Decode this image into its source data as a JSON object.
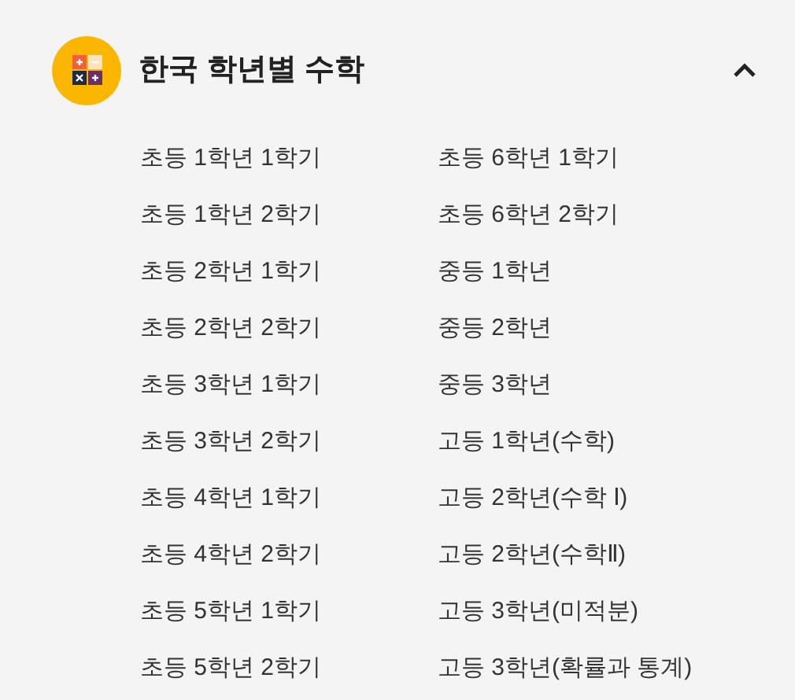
{
  "section": {
    "title": "한국 학년별 수학",
    "expanded": true,
    "items": [
      "초등 1학년 1학기",
      "초등 1학년 2학기",
      "초등 2학년 1학기",
      "초등 2학년 2학기",
      "초등 3학년 1학기",
      "초등 3학년 2학기",
      "초등 4학년 1학기",
      "초등 4학년 2학기",
      "초등 5학년 1학기",
      "초등 5학년 2학기",
      "초등 6학년 1학기",
      "초등 6학년 2학기",
      "중등 1학년",
      "중등 2학년",
      "중등 3학년",
      "고등 1학년(수학)",
      "고등 2학년(수학 Ⅰ)",
      "고등 2학년(수학Ⅱ)",
      "고등 3학년(미적분)",
      "고등 3학년(확률과 통계)"
    ]
  }
}
